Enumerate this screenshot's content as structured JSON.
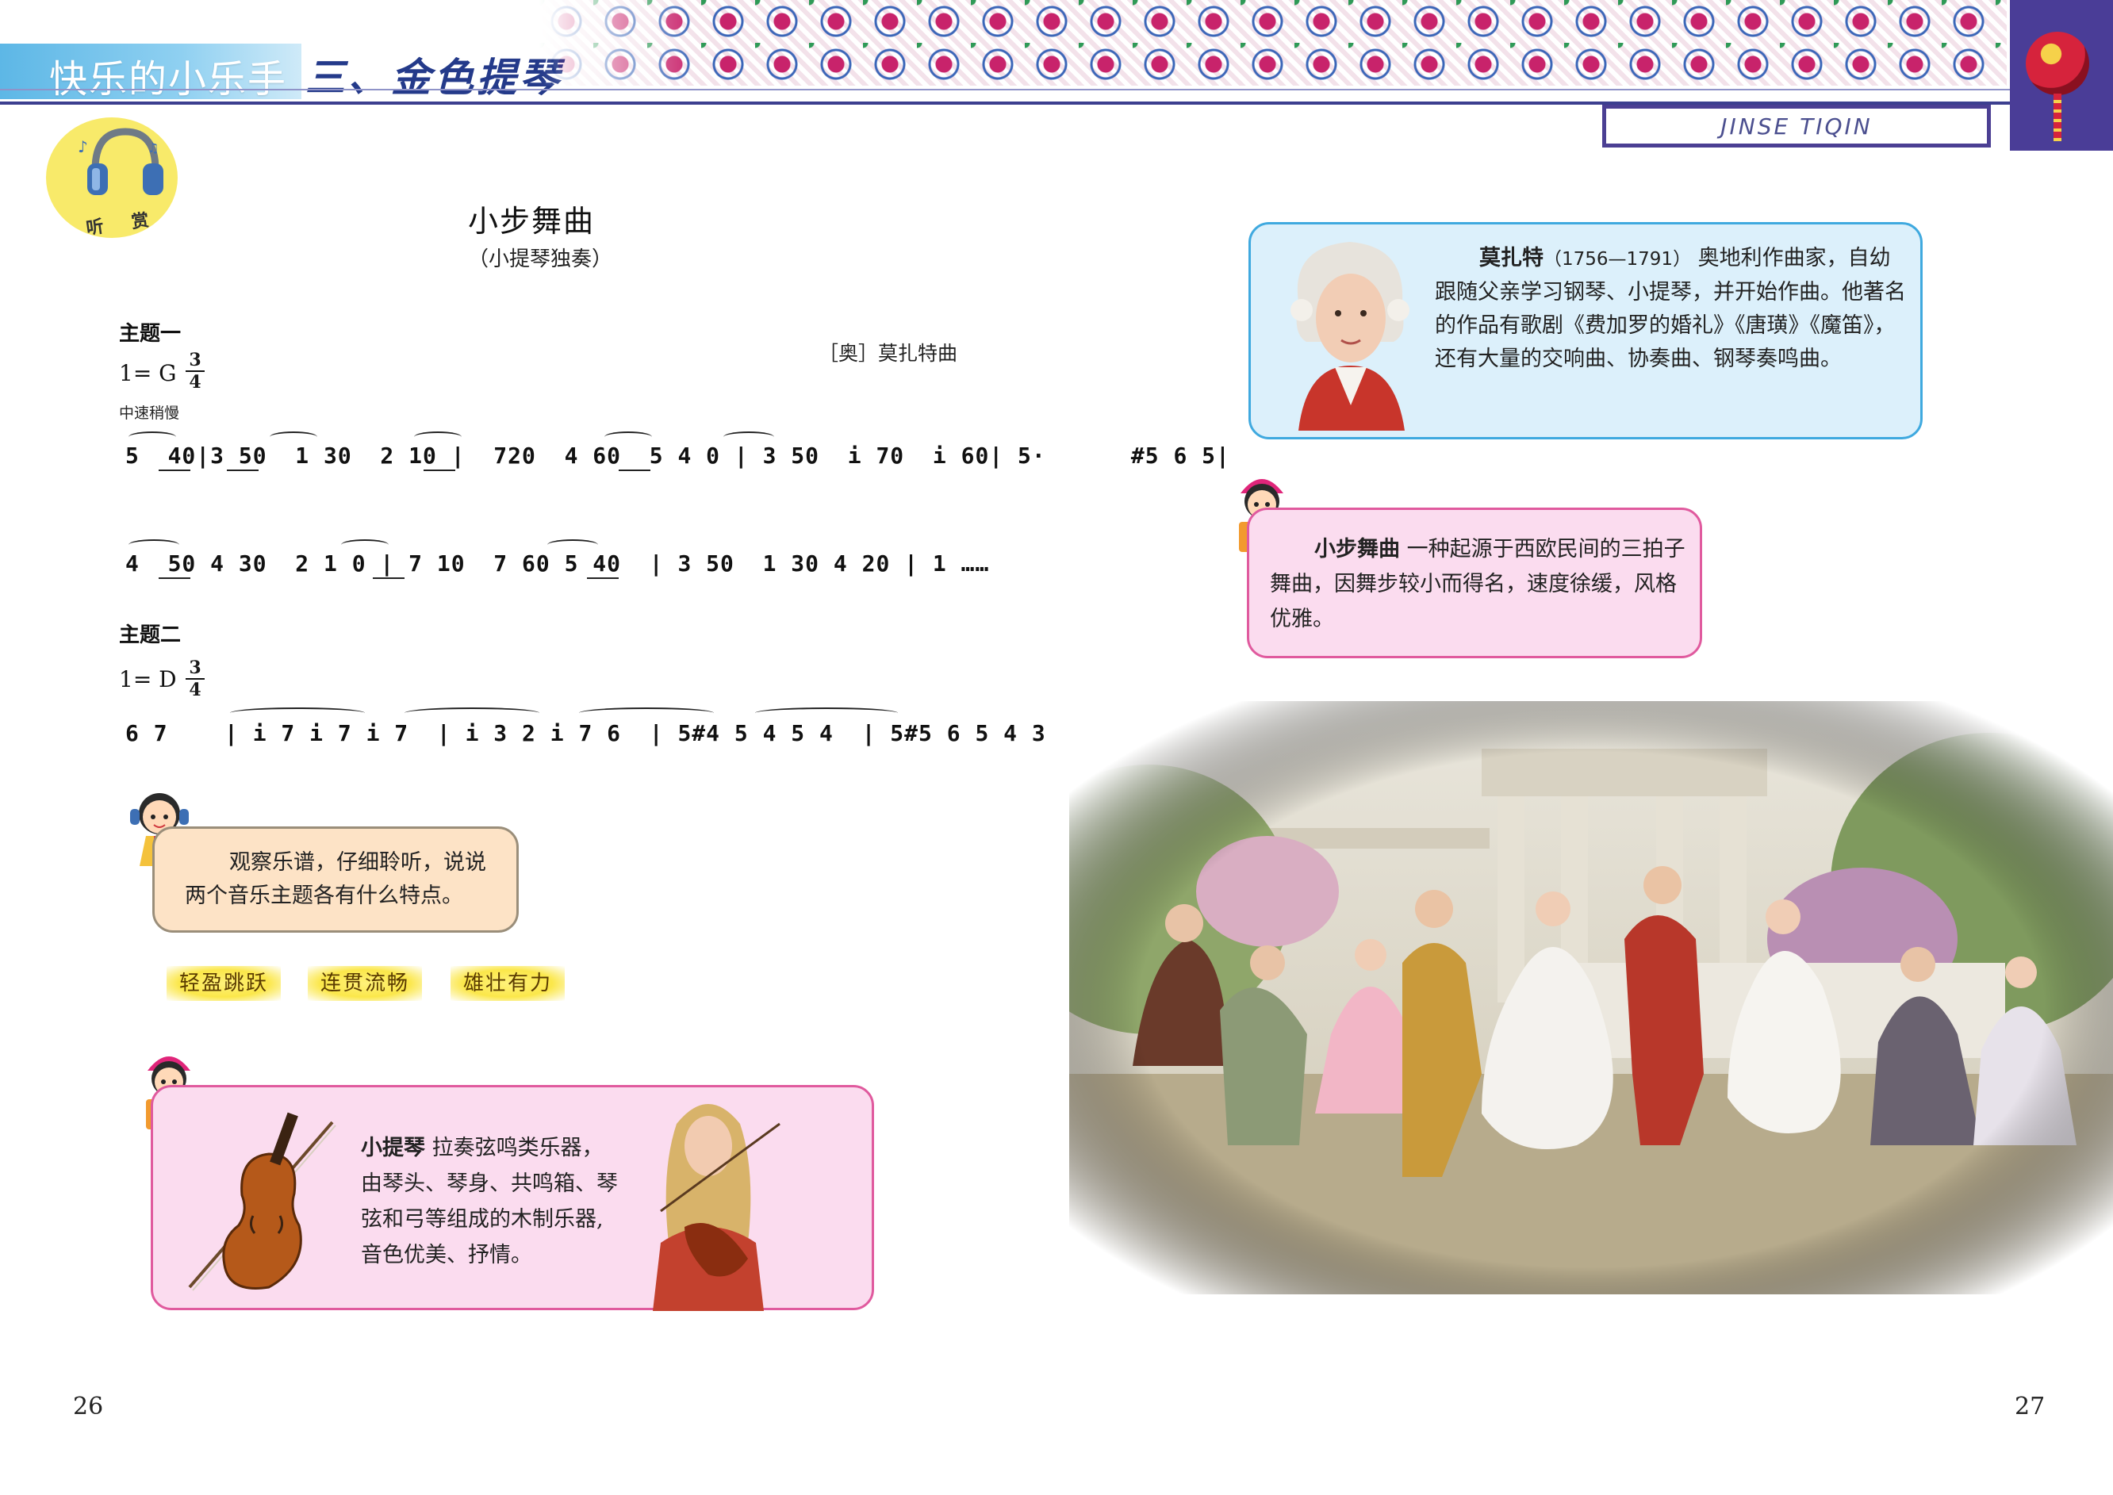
{
  "header": {
    "series_title": "快乐的小乐手",
    "lesson_title": "三、金色提琴",
    "pinyin": "JINSE TIQIN"
  },
  "badge": {
    "label": "听 赏",
    "icon": "headphone-icon"
  },
  "piece": {
    "title": "小步舞曲",
    "subtitle": "（小提琴独奏）",
    "composer": "［奥］莫扎特曲"
  },
  "theme1": {
    "label": "主题一",
    "key": "1= G",
    "time_top": "3",
    "time_bottom": "4",
    "tempo": "中速稍慢",
    "line1": "5  40|3 50  1 30  2 10 |  720  4 60  5 4 0 | 3 50  i 70  i 60| 5·      #5 6 5|",
    "line2": "4  50 4 30  2 1 0 | 7 10  7 60 5 40  | 3 50  1 30 4 20 | 1 ……"
  },
  "theme2": {
    "label": "主题二",
    "key": "1= D",
    "time_top": "3",
    "time_bottom": "4",
    "line1": "6 7    | i 7 i 7 i 7  | i 3 2 i 7 6  | 5#4 5 4 5 4  | 5#5 6 5 4 3  |……"
  },
  "question": {
    "text": "观察乐谱，仔细聆听，说说两个音乐主题各有什么特点。"
  },
  "tags": [
    "轻盈跳跃",
    "连贯流畅",
    "雄壮有力"
  ],
  "violin": {
    "term": "小提琴",
    "text": "  拉奏弦鸣类乐器，由琴头、琴身、共鸣箱、琴弦和弓等组成的木制乐器,音色优美、抒情。"
  },
  "mozart": {
    "name": "莫扎特",
    "years": "（1756—1791）",
    "text": "  奥地利作曲家，自幼跟随父亲学习钢琴、小提琴，并开始作曲。他著名的作品有歌剧《费加罗的婚礼》《唐璜》《魔笛》，还有大量的交响曲、协奏曲、钢琴奏鸣曲。"
  },
  "minuet": {
    "term": "小步舞曲",
    "text": "  一种起源于西欧民间的三拍子舞曲，因舞步较小而得名，速度徐缓，风格优雅。"
  },
  "page_numbers": {
    "left": "26",
    "right": "27"
  },
  "colors": {
    "header_blue": "#5db7e6",
    "title_navy": "#243a8a",
    "accent_purple": "#4a3d97",
    "pink_box": "#fbdcef",
    "pink_border": "#e05a9e",
    "blue_box": "#dcf0fb",
    "blue_border": "#3fa9df",
    "question_box": "#fde3c6",
    "tag_yellow": "#fbe74a"
  }
}
